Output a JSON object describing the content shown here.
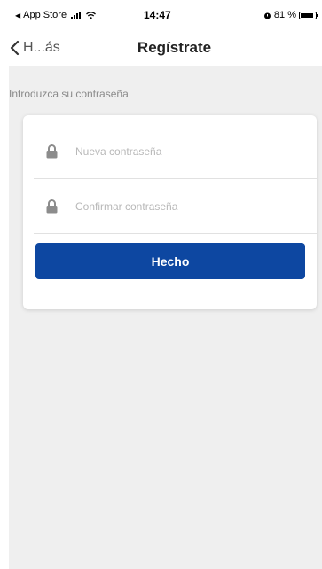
{
  "status_bar": {
    "carrier": "App Store",
    "time": "14:47",
    "battery": "81 %"
  },
  "nav": {
    "back_label": "H...ás",
    "title": "Regístrate"
  },
  "form": {
    "section_label": "Introduzca su contraseña",
    "new_password_placeholder": "Nueva contraseña",
    "confirm_password_placeholder": "Confirmar contraseña",
    "submit_label": "Hecho"
  },
  "colors": {
    "primary_button": "#0d47a1",
    "page_background": "#efefef"
  },
  "icons": {
    "status": [
      "back-arrow-icon",
      "signal-icon",
      "wifi-icon",
      "alarm-icon",
      "battery-icon"
    ],
    "fields": [
      "lock-icon",
      "lock-icon"
    ],
    "nav": "chevron-left-icon"
  }
}
